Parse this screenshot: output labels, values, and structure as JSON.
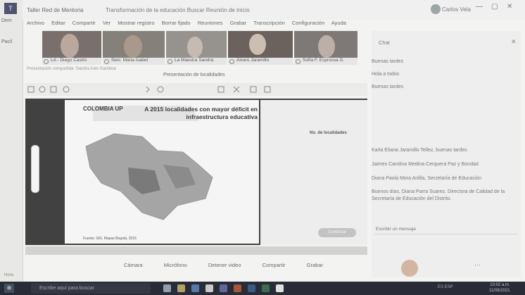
{
  "strip": {
    "app_logo": "T",
    "label_1": "Dem",
    "label_2": "Pacil"
  },
  "title_bar": {
    "meeting_title": "Taller Red de Mentoria",
    "extra": "Transformación de la educación     Buscar   Reunión de Inicio",
    "user_name": "Carlos Vela",
    "min": "—",
    "max": "▢",
    "close": "✕"
  },
  "menu": [
    "Archivo",
    "Editar",
    "Compartir",
    "Ver",
    "Mostrar registro",
    "Borrar fijado",
    "Reuniones",
    "Grabar",
    "Transcripción",
    "Configuración",
    "Ayuda"
  ],
  "participants": [
    {
      "name": "LA - Diego Castro"
    },
    {
      "name": "Secr. Maria Isabel"
    },
    {
      "name": "La Maestra Sandra"
    },
    {
      "name": "Alvaro Jaramillo"
    },
    {
      "name": "Sofía F. Espinosa G."
    }
  ],
  "viewer": {
    "sidebar_hint": "Presentación compartida: Sandra Inés Gamboa",
    "doc_title": "Presentación de localidades",
    "slide_title": "A 2015 localidades con mayor déficit en infraestructura educativa",
    "slide_logo": "COLOMBIA UP",
    "slide_footer": "Fuente: SIG. Mapas Bogotá, 2015",
    "panel_heading": "No. de localidades",
    "panel_button": "Continuar"
  },
  "chat": {
    "title": "Chat",
    "close": "✕",
    "messages": [
      "Buenas tardes",
      "Hola a todos",
      "Buenas tardes",
      "Karla Eliana Jaramillo Tellez, buenas tardes",
      "Jaimes Carolina Medina Cerquera Paz y Bondad",
      "Diana Paola Mora Ardila, Secretaría de Educación",
      "Buenos días, Diana Parra Suarez. Directora de Calidad de la Secretaría de Educación del Distrito."
    ],
    "input_placeholder": "Escribir un mensaje"
  },
  "controls": [
    "Cámara",
    "Micrófono",
    "Detener video",
    "Compartir",
    "Grabar"
  ],
  "taskbar": {
    "start": "⊞",
    "search_placeholder": "Escribe aquí para buscar",
    "tray": "ES  ESP",
    "time": "10:02 a.m.",
    "date": "11/08/2021"
  },
  "bottom_label": "Hora"
}
